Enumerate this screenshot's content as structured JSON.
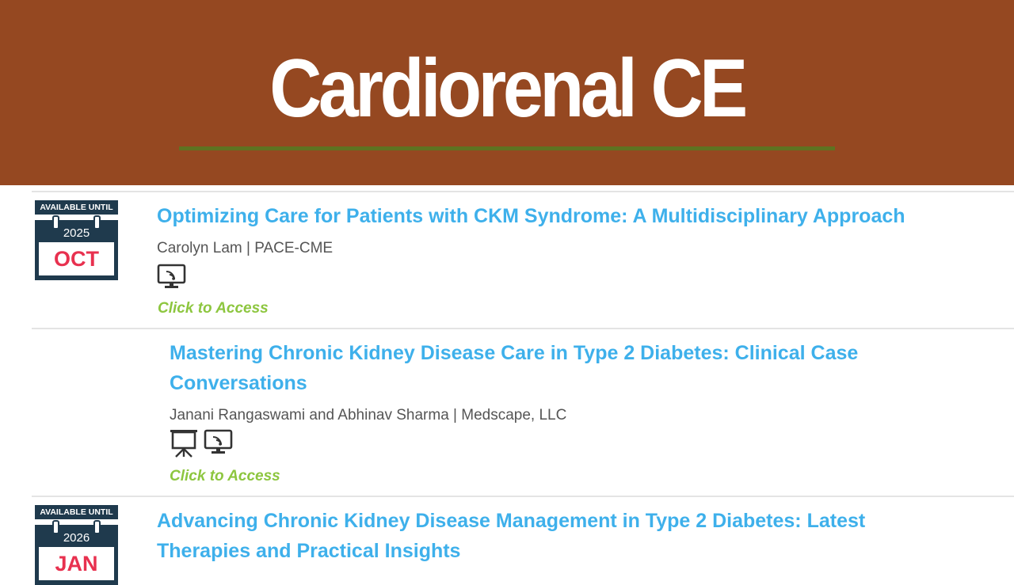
{
  "header": {
    "title": "Cardiorenal CE",
    "background_color": "#954821",
    "rule_color": "#5e7321"
  },
  "badge_label": "AVAILABLE UNTIL",
  "items": [
    {
      "badge": {
        "year": "2025",
        "month": "OCT"
      },
      "title": "Optimizing Care for Patients with CKM Syndrome: A Multidisciplinary Approach",
      "author": "Carolyn Lam | PACE-CME",
      "icons": [
        "online-monitor-icon"
      ],
      "access": "Click to Access"
    },
    {
      "title_line1": "Mastering Chronic Kidney Disease Care in Type 2 Diabetes: Clinical Case",
      "title_line2": "Conversations",
      "author": "Janani Rangaswami and Abhinav Sharma | Medscape, LLC",
      "icons": [
        "presentation-easel-icon",
        "online-monitor-icon"
      ],
      "access": "Click to Access"
    },
    {
      "badge": {
        "year": "2026",
        "month": "JAN"
      },
      "title_line1": "Advancing Chronic Kidney Disease Management in Type 2 Diabetes: Latest",
      "title_line2": "Therapies and Practical Insights"
    }
  ],
  "colors": {
    "title_link": "#3eb0eb",
    "access_link": "#8dc63f",
    "badge_dark": "#1f3a4d",
    "badge_month": "#e8314f"
  }
}
